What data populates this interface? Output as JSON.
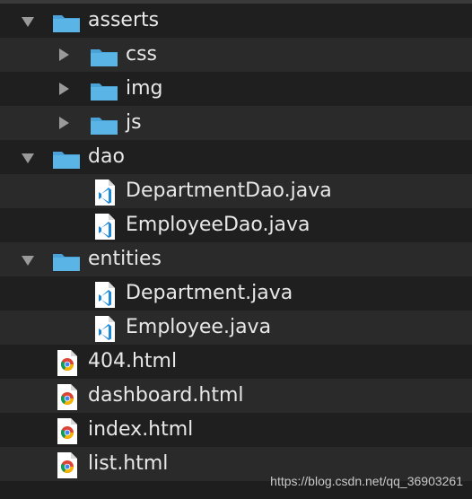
{
  "tree": {
    "items": [
      {
        "label": "asserts",
        "type": "folder",
        "expanded": true,
        "depth": 0
      },
      {
        "label": "css",
        "type": "folder",
        "expanded": false,
        "depth": 1
      },
      {
        "label": "img",
        "type": "folder",
        "expanded": false,
        "depth": 1
      },
      {
        "label": "js",
        "type": "folder",
        "expanded": false,
        "depth": 1
      },
      {
        "label": "dao",
        "type": "folder",
        "expanded": true,
        "depth": 0
      },
      {
        "label": "DepartmentDao.java",
        "type": "java",
        "depth": 1
      },
      {
        "label": "EmployeeDao.java",
        "type": "java",
        "depth": 1
      },
      {
        "label": "entities",
        "type": "folder",
        "expanded": true,
        "depth": 0
      },
      {
        "label": "Department.java",
        "type": "java",
        "depth": 1
      },
      {
        "label": "Employee.java",
        "type": "java",
        "depth": 1
      },
      {
        "label": "404.html",
        "type": "html",
        "depth": 0
      },
      {
        "label": "dashboard.html",
        "type": "html",
        "depth": 0
      },
      {
        "label": "index.html",
        "type": "html",
        "depth": 0
      },
      {
        "label": "list.html",
        "type": "html",
        "depth": 0
      }
    ]
  },
  "watermark": "https://blog.csdn.net/qq_36903261",
  "colors": {
    "background": "#1e1e1e",
    "row_alt": "#2a2a2a",
    "folder": "#5ab5e6",
    "java_icon_accent": "#1e88d8"
  },
  "icons": {
    "folder": "folder-icon",
    "java": "vscode-java-file-icon",
    "html": "chrome-html-file-icon",
    "expanded": "disclosure-triangle-down",
    "collapsed": "disclosure-triangle-right"
  }
}
